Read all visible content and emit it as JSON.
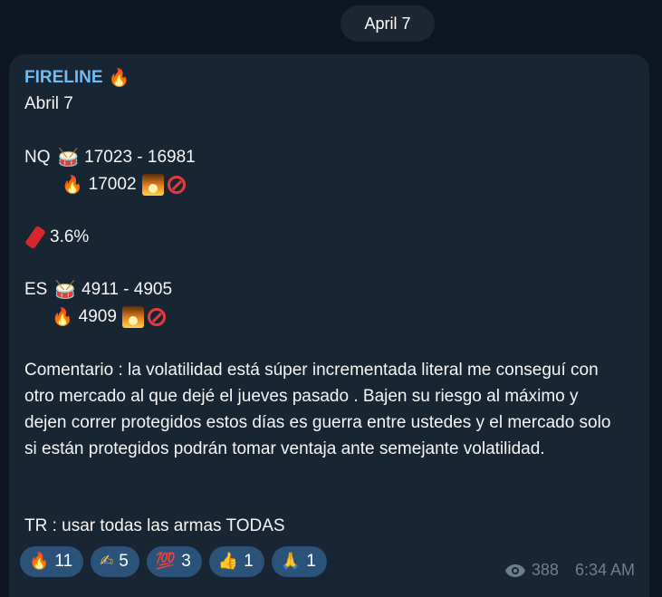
{
  "date_pill": "April 7",
  "message": {
    "sender": "FIRELINE",
    "sender_emoji": "🔥",
    "subtitle": "Abril 7",
    "nq_label": "NQ",
    "nq_range": "17023 - 16981",
    "nq_level": "17002",
    "dynamite_value": "3.6%",
    "es_label": "ES",
    "es_range": "4911 - 4905",
    "es_level": "4909",
    "comment": "Comentario : la volatilidad está súper incrementada literal me conseguí con otro mercado al que dejé el jueves pasado . Bajen su riesgo al máximo y dejen correr protegidos estos días es guerra entre ustedes y el mercado solo si están protegidos podrán tomar ventaja ante semejante volatilidad.",
    "tr": "TR : usar todas las armas TODAS"
  },
  "reactions": [
    {
      "icon": "🔥",
      "count": "11"
    },
    {
      "icon": "✍",
      "count": "5"
    },
    {
      "icon": "💯",
      "count": "3"
    },
    {
      "icon": "👍",
      "count": "1"
    },
    {
      "icon": "🙏",
      "count": "1"
    }
  ],
  "meta": {
    "views": "388",
    "time": "6:34 AM"
  },
  "colors": {
    "background": "#0e1621",
    "bubble": "#182533",
    "sender": "#71baf2",
    "reaction_bg": "#2b5278"
  }
}
